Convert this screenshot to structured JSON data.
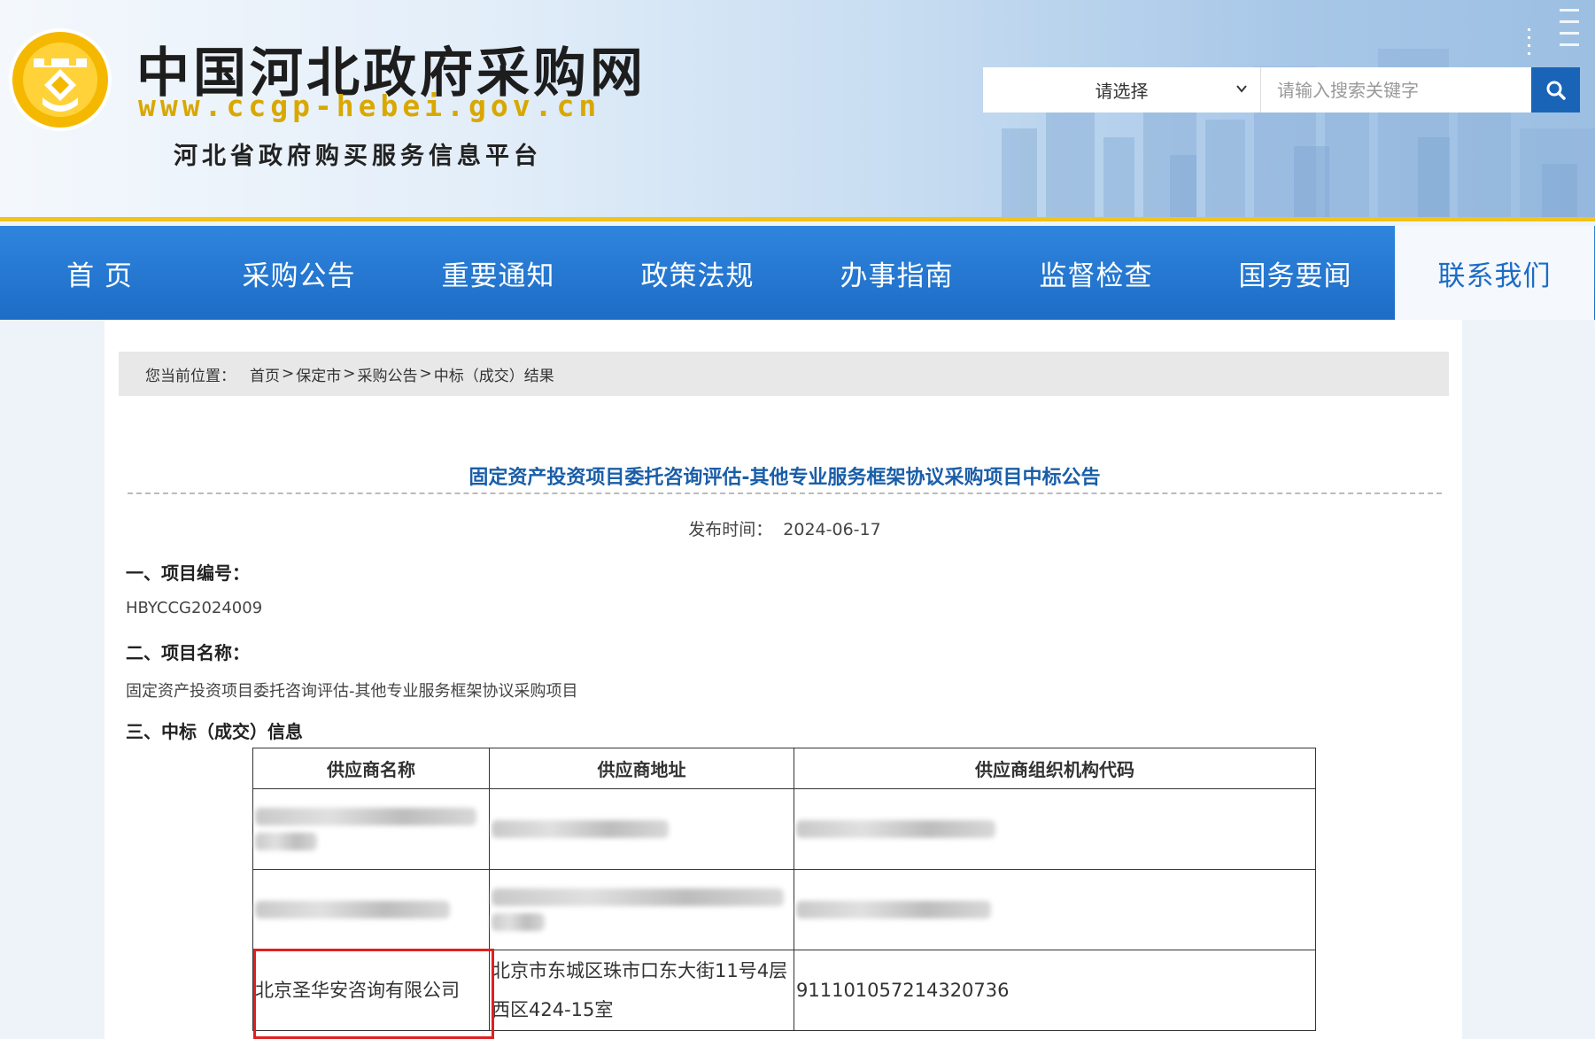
{
  "header": {
    "site_title": "中国河北政府采购网",
    "site_url": "www.ccgp-hebei.gov.cn",
    "site_subtitle": "河北省政府购买服务信息平台"
  },
  "search": {
    "select_value": "请选择",
    "placeholder": "请输入搜索关键字"
  },
  "nav": {
    "items": [
      {
        "label": "首 页"
      },
      {
        "label": "采购公告"
      },
      {
        "label": "重要通知"
      },
      {
        "label": "政策法规"
      },
      {
        "label": "办事指南"
      },
      {
        "label": "监督检查"
      },
      {
        "label": "国务要闻"
      },
      {
        "label": "联系我们"
      }
    ]
  },
  "breadcrumb": {
    "label": "您当前位置：",
    "items": [
      "首页",
      "保定市",
      "采购公告",
      "中标（成交）结果"
    ],
    "separator": ">"
  },
  "article": {
    "title": "固定资产投资项目委托咨询评估-其他专业服务框架协议采购项目中标公告",
    "pub_time_label": "发布时间：",
    "pub_time": "2024-06-17",
    "sec1_heading": "一、项目编号：",
    "sec1_value": "HBYCCG2024009",
    "sec2_heading": "二、项目名称：",
    "sec2_value": "固定资产投资项目委托咨询评估-其他专业服务框架协议采购项目",
    "sec3_heading": "三、中标（成交）信息"
  },
  "table": {
    "headers": [
      "供应商名称",
      "供应商地址",
      "供应商组织机构代码"
    ],
    "highlighted_row": {
      "name": "北京圣华安咨询有限公司",
      "address": "北京市东城区珠市口东大街11号4层西区424-15室",
      "code": "911101057214320736"
    }
  },
  "colors": {
    "nav_blue": "#1d6cc6",
    "title_blue": "#1a5ea8",
    "highlight_red": "#e02020",
    "header_gold": "#f2c318"
  }
}
